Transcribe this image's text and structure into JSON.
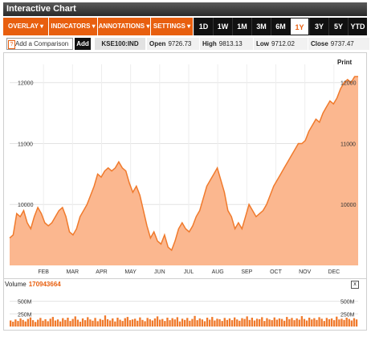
{
  "title": "Interactive Chart",
  "menus": [
    "OVERLAY ▾",
    "INDICATORS ▾",
    "ANNOTATIONS ▾",
    "SETTINGS ▾"
  ],
  "ranges": [
    "1D",
    "1W",
    "1M",
    "3M",
    "6M",
    "1Y",
    "3Y",
    "5Y",
    "YTD"
  ],
  "active_range": "1Y",
  "compare_label": "Add a Comparison",
  "compare_icon": "?",
  "add_label": "Add",
  "ticker": "KSE100:IND",
  "stats": {
    "open_label": "Open",
    "open": "9726.73",
    "high_label": "High",
    "high": "9813.13",
    "low_label": "Low",
    "low": "9712.02",
    "close_label": "Close",
    "close": "9737.47"
  },
  "print_label": "Print",
  "volume_label": "Volume",
  "volume_value": "170943664",
  "close_icon": "x",
  "colors": {
    "accent": "#e85f0f",
    "area": "#fbb78f",
    "line": "#f07a2c"
  },
  "chart_data": [
    {
      "type": "area",
      "x_tick_labels": [
        "FEB",
        "MAR",
        "APR",
        "MAY",
        "JUN",
        "JUL",
        "AUG",
        "SEP",
        "OCT",
        "NOV",
        "DEC"
      ],
      "y_tick_labels": [
        "10000",
        "11000",
        "12000"
      ],
      "ylim": [
        9000,
        12300
      ],
      "grid": true,
      "series": [
        {
          "x": [
            0,
            1,
            2,
            3,
            4,
            5,
            6,
            7,
            8,
            9,
            10,
            11,
            12,
            13,
            14,
            15,
            16,
            17,
            18,
            19,
            20,
            21,
            22,
            23,
            24,
            25,
            26,
            27,
            28,
            29,
            30,
            31,
            32,
            33,
            34,
            35,
            36,
            37,
            38,
            39,
            40,
            41,
            42,
            43,
            44,
            45,
            46,
            47,
            48,
            49,
            50,
            51,
            52,
            53,
            54,
            55,
            56,
            57,
            58,
            59,
            60,
            61,
            62,
            63,
            64,
            65,
            66,
            67,
            68,
            69,
            70,
            71,
            72,
            73,
            74,
            75,
            76,
            77,
            78,
            79,
            80,
            81,
            82,
            83,
            84,
            85,
            86,
            87,
            88,
            89,
            90,
            91,
            92,
            93,
            94,
            95,
            96,
            97,
            98,
            99
          ],
          "values": [
            9450,
            9500,
            9850,
            9800,
            9900,
            9700,
            9600,
            9800,
            9950,
            9850,
            9700,
            9650,
            9700,
            9800,
            9900,
            9950,
            9800,
            9550,
            9500,
            9600,
            9800,
            9900,
            10000,
            10150,
            10300,
            10500,
            10450,
            10550,
            10600,
            10550,
            10600,
            10700,
            10600,
            10550,
            10350,
            10200,
            10300,
            10150,
            9900,
            9650,
            9450,
            9550,
            9400,
            9350,
            9500,
            9300,
            9250,
            9400,
            9600,
            9700,
            9600,
            9550,
            9650,
            9800,
            9900,
            10100,
            10300,
            10400,
            10500,
            10600,
            10400,
            10200,
            9900,
            9800,
            9600,
            9700,
            9600,
            9800,
            10000,
            9900,
            9800,
            9850,
            9900,
            10000,
            10150,
            10300,
            10400,
            10500,
            10600,
            10700,
            10800,
            10900,
            11000,
            11000,
            11050,
            11200,
            11300,
            11400,
            11350,
            11500,
            11600,
            11700,
            11650,
            11750,
            11900,
            12000,
            12050,
            12000,
            12100,
            12100
          ]
        }
      ]
    },
    {
      "type": "bar",
      "y_tick_labels": [
        "250M",
        "500M"
      ],
      "ylim": [
        0,
        700
      ],
      "bar_count": 140,
      "values": [
        120,
        95,
        140,
        110,
        160,
        130,
        100,
        150,
        180,
        125,
        90,
        135,
        170,
        115,
        145,
        105,
        155,
        190,
        120,
        140,
        100,
        165,
        130,
        175,
        110,
        150,
        200,
        135,
        95,
        160,
        125,
        185,
        140,
        115,
        170,
        105,
        150,
        130,
        220,
        145,
        120,
        160,
        100,
        175,
        135,
        110,
        165,
        190,
        125,
        140,
        155,
        115,
        180,
        130,
        105,
        170,
        145,
        120,
        160,
        200,
        135,
        150,
        110,
        175,
        125,
        165,
        140,
        185,
        100,
        155,
        130,
        170,
        115,
        150,
        210,
        125,
        160,
        140,
        105,
        175,
        135,
        190,
        120,
        155,
        145,
        110,
        170,
        130,
        160,
        125,
        180,
        140,
        115,
        165,
        150,
        200,
        130,
        175,
        120,
        155,
        145,
        185,
        110,
        165,
        140,
        125,
        180,
        135,
        160,
        150,
        115,
        190,
        145,
        170,
        125,
        160,
        135,
        205,
        150,
        120,
        175,
        140,
        165,
        130,
        185,
        155,
        110,
        170,
        145,
        160,
        125,
        195,
        140,
        155,
        130,
        175,
        150,
        120,
        165,
        140
      ]
    }
  ]
}
